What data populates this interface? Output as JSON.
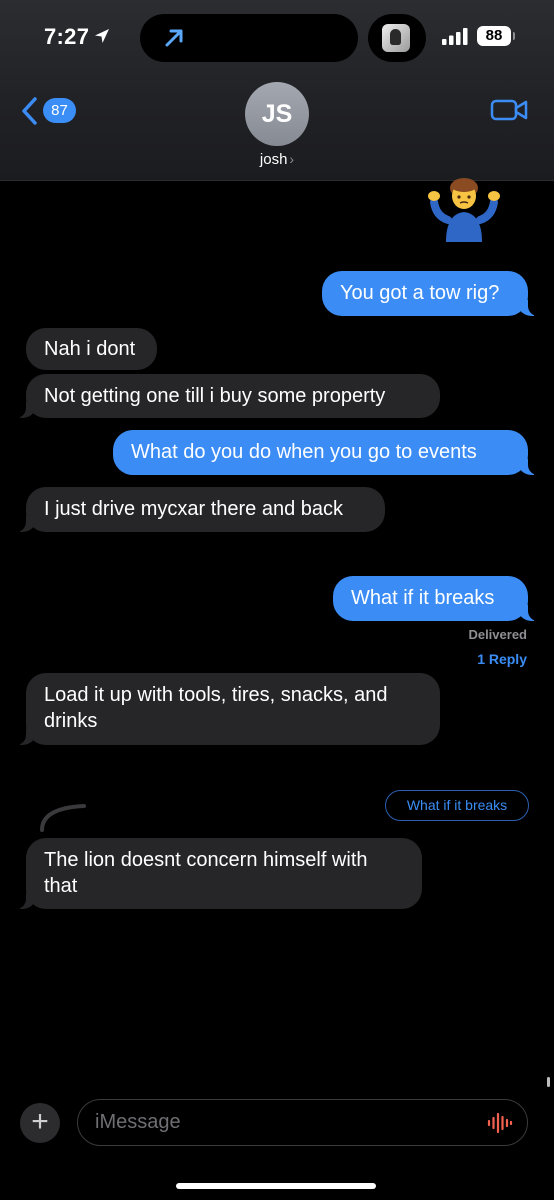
{
  "status_bar": {
    "time": "7:27",
    "battery": "88"
  },
  "header": {
    "back_count": "87",
    "avatar_initials": "JS",
    "contact_name": "josh",
    "contact_chevron": "›"
  },
  "icons": {
    "location": "location-arrow-icon",
    "island": "navigation-arrow-icon",
    "signal": "cellular-signal-icon",
    "back": "chevron-left-icon",
    "video": "video-camera-icon",
    "plus": "plus-icon",
    "audio": "waveform-icon"
  },
  "colors": {
    "outgoing_bubble": "#3b8df5",
    "incoming_bubble": "#262628",
    "accent": "#3b8df5"
  },
  "messages": [
    {
      "direction": "out",
      "type": "emoji",
      "emoji_name": "person-shrugging"
    },
    {
      "direction": "out",
      "text": "You got a tow rig?"
    },
    {
      "direction": "in",
      "text": "Nah i dont"
    },
    {
      "direction": "in",
      "text": "Not getting one till i buy some property"
    },
    {
      "direction": "out",
      "text": "What do you do when you go to events"
    },
    {
      "direction": "in",
      "text": "I just drive mycxar there and back"
    },
    {
      "direction": "out",
      "text": "What if it breaks"
    },
    {
      "direction": "in",
      "text": "Load it up with tools, tires, snacks, and drinks"
    },
    {
      "direction": "in",
      "text": "The lion doesnt concern himself with that"
    }
  ],
  "delivery": {
    "status": "Delivered",
    "reply_count": "1 Reply"
  },
  "thread_reply": {
    "quoted": "What if it breaks"
  },
  "compose": {
    "placeholder": "iMessage",
    "plus_label": "+"
  }
}
